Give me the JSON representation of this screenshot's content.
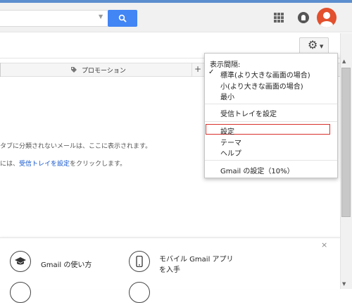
{
  "header": {
    "search_placeholder": "",
    "colors": {
      "search_button": "#4285f4",
      "avatar": "#e2502d",
      "header_bg": "#f1f1f1"
    }
  },
  "icons": {
    "search": "search-icon",
    "apps": "apps-grid-icon",
    "notifications": "notifications-icon",
    "settings": "gear-icon",
    "tag": "tag-icon",
    "graduation_cap": "graduation-cap-icon",
    "phone": "mobile-phone-icon"
  },
  "tabs": {
    "promotions_label": "プロモーション",
    "add_label": "+"
  },
  "inbox_message": {
    "line_1": "タブに分類されないメールは、ここに表示されます。",
    "line_2_prefix": "には、",
    "line_2_link": "受信トレイを設定",
    "line_2_suffix": "をクリックします。"
  },
  "settings_menu": {
    "density_heading": "表示間隔:",
    "density_options": [
      {
        "label": "標準(より大きな画面の場合)",
        "checked": true
      },
      {
        "label": "小(より大きな画面の場合)",
        "checked": false
      },
      {
        "label": "最小",
        "checked": false
      }
    ],
    "configure_inbox": "受信トレイを設定",
    "settings": "設定",
    "themes": "テーマ",
    "help": "ヘルプ",
    "gmail_settings": "Gmail の設定（10%）",
    "highlight_color": "#d9302c"
  },
  "bottom_panel": {
    "close_label": "×",
    "tip_how_to": "Gmail の使い方",
    "tip_mobile_line_1": "モバイル Gmail アプリ",
    "tip_mobile_line_2": "を入手"
  }
}
